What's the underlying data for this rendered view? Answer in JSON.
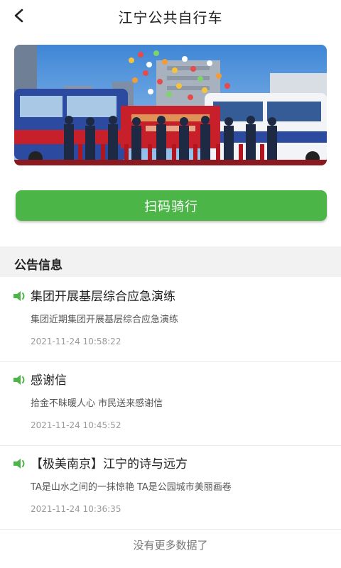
{
  "header": {
    "title": "江宁公共自行车"
  },
  "banner": {
    "colors": {
      "sky": "#4a8fd8",
      "stage": "#c8202a",
      "bus": "#2b4aa0"
    }
  },
  "action": {
    "scan_label": "扫码骑行",
    "color": "#4cb548"
  },
  "notices": {
    "section_title": "公告信息",
    "items": [
      {
        "title": "集团开展基层综合应急演练",
        "desc": "集团近期集团开展基层综合应急演练",
        "time": "2021-11-24 10:58:22"
      },
      {
        "title": "感谢信",
        "desc": "拾金不昧暖人心 市民送来感谢信",
        "time": "2021-11-24 10:45:52"
      },
      {
        "title": "【极美南京】江宁的诗与远方",
        "desc": "TA是山水之间的一抹惊艳 TA是公园城市美丽画卷",
        "time": "2021-11-24 10:36:35"
      }
    ],
    "no_more": "没有更多数据了"
  }
}
